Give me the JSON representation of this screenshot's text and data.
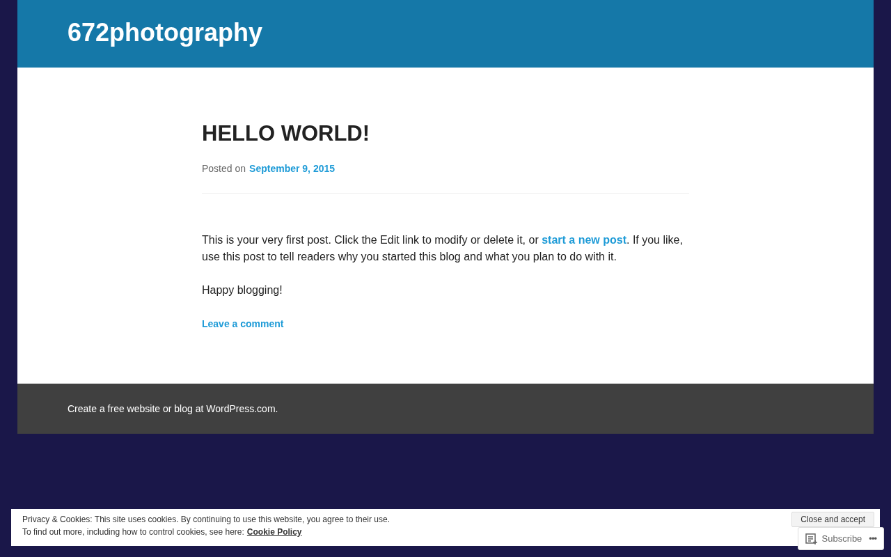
{
  "site": {
    "title": "672photography"
  },
  "post": {
    "title": "HELLO WORLD!",
    "posted_label": "Posted on",
    "date": "September 9, 2015",
    "paragraphs": [
      {
        "parts": [
          {
            "kind": "text",
            "text": "This is your very first post. Click the Edit link to modify or delete it, or "
          },
          {
            "kind": "link",
            "text": "start a new post"
          },
          {
            "kind": "text",
            "text": ". If you like, use this post to tell readers why you started this blog and what you plan to do with it."
          }
        ]
      },
      {
        "parts": [
          {
            "kind": "text",
            "text": "Happy blogging!"
          }
        ]
      }
    ],
    "comment_link": "Leave a comment"
  },
  "footer": {
    "credit": "Create a free website or blog at WordPress.com."
  },
  "cookie_bar": {
    "line_1": "Privacy & Cookies: This site uses cookies. By continuing to use this website, you agree to their use.",
    "line_2": "To find out more, including how to control cookies, see here:",
    "policy_link": "Cookie Policy",
    "accept_button": "Close and accept"
  },
  "subscribe_bar": {
    "label": "Subscribe",
    "more": "•••"
  }
}
